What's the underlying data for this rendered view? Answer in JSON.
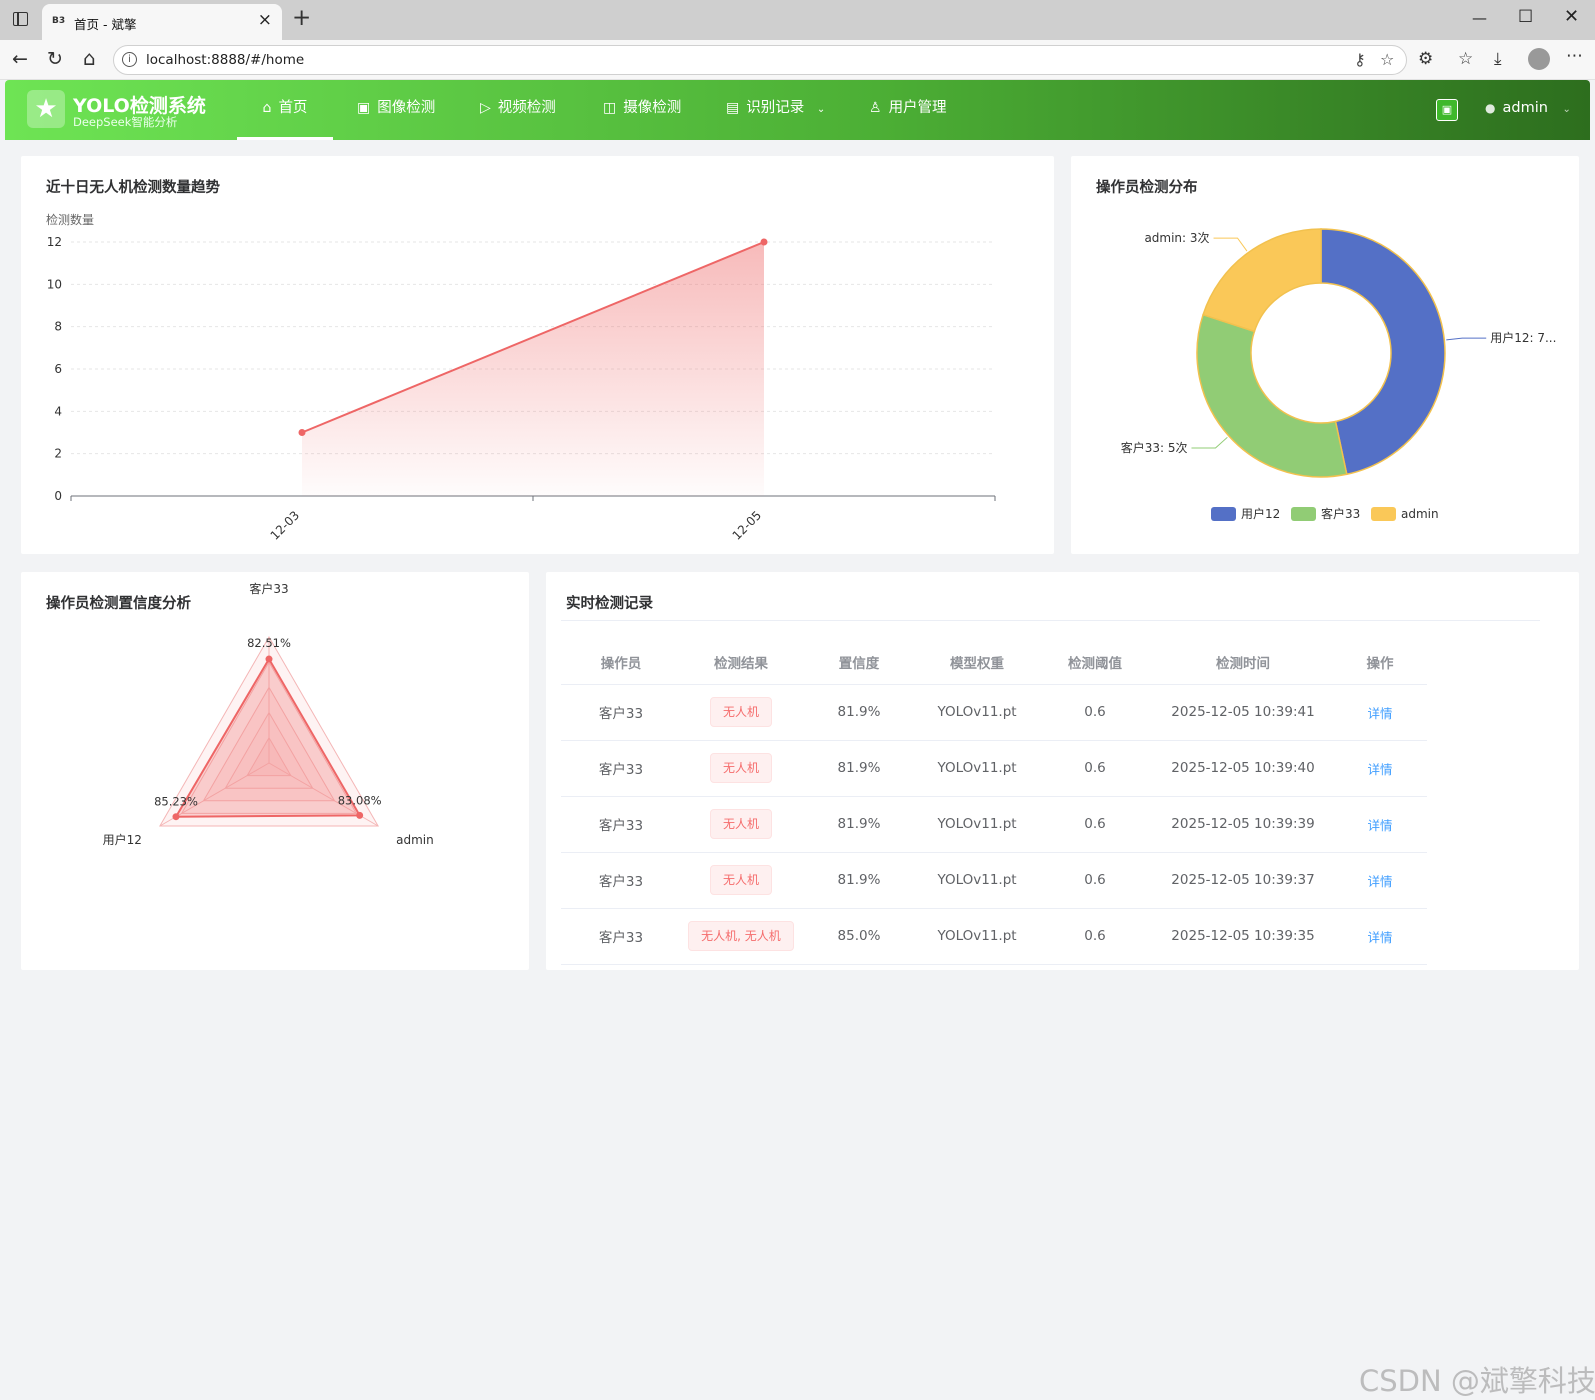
{
  "browser": {
    "tab_favicon": "B3",
    "tab_title": "首页 - 斌擎",
    "url": "localhost:8888/#/home"
  },
  "header": {
    "logo_title": "YOLO检测系统",
    "logo_subtitle": "DeepSeek智能分析",
    "nav": [
      {
        "label": "首页",
        "icon": "home-icon"
      },
      {
        "label": "图像检测",
        "icon": "image-icon"
      },
      {
        "label": "视频检测",
        "icon": "play-icon"
      },
      {
        "label": "摄像检测",
        "icon": "camera-icon"
      },
      {
        "label": "识别记录",
        "icon": "document-icon"
      },
      {
        "label": "用户管理",
        "icon": "user-icon"
      }
    ],
    "active_nav": "首页",
    "user_name": "admin"
  },
  "trend_card": {
    "title": "近十日无人机检测数量趋势"
  },
  "distribution_card": {
    "title": "操作员检测分布"
  },
  "radar_card": {
    "title": "操作员检测置信度分析"
  },
  "records_card": {
    "title": "实时检测记录",
    "columns": [
      "操作员",
      "检测结果",
      "置信度",
      "模型权重",
      "检测阈值",
      "检测时间",
      "操作"
    ],
    "rows": [
      {
        "operator": "客户33",
        "result": "无人机",
        "confidence": "81.9%",
        "model": "YOLOv11.pt",
        "threshold": "0.6",
        "time": "2025-12-05 10:39:41",
        "action": "详情"
      },
      {
        "operator": "客户33",
        "result": "无人机",
        "confidence": "81.9%",
        "model": "YOLOv11.pt",
        "threshold": "0.6",
        "time": "2025-12-05 10:39:40",
        "action": "详情"
      },
      {
        "operator": "客户33",
        "result": "无人机",
        "confidence": "81.9%",
        "model": "YOLOv11.pt",
        "threshold": "0.6",
        "time": "2025-12-05 10:39:39",
        "action": "详情"
      },
      {
        "operator": "客户33",
        "result": "无人机",
        "confidence": "81.9%",
        "model": "YOLOv11.pt",
        "threshold": "0.6",
        "time": "2025-12-05 10:39:37",
        "action": "详情"
      },
      {
        "operator": "客户33",
        "result": "无人机, 无人机",
        "confidence": "85.0%",
        "model": "YOLOv11.pt",
        "threshold": "0.6",
        "time": "2025-12-05 10:39:35",
        "action": "详情"
      }
    ]
  },
  "chart_data": [
    {
      "type": "area",
      "categories": [
        "12-03",
        "12-05"
      ],
      "values": [
        3,
        12
      ],
      "ylabel": "检测数量",
      "ylim": [
        0,
        12
      ],
      "yticks": [
        "0",
        "2",
        "4",
        "6",
        "8",
        "10",
        "12"
      ],
      "color": "#ee6666",
      "grid": true
    },
    {
      "type": "pie",
      "donut": true,
      "labels": [
        "用户12",
        "客户33",
        "admin"
      ],
      "values": [
        7,
        5,
        3
      ],
      "slice_labels": [
        "用户12: 7...",
        "客户33: 5次",
        "admin: 3次"
      ],
      "colors": [
        "#5470c6",
        "#91cc75",
        "#fac858"
      ],
      "legend": "bottom"
    },
    {
      "type": "radar",
      "indicators": [
        "客户33",
        "admin",
        "用户12"
      ],
      "values": [
        82.51,
        83.08,
        85.23
      ],
      "value_labels": [
        "82.51%",
        "83.08%",
        "85.23%"
      ],
      "max": 100,
      "color": "#ee6666"
    }
  ],
  "watermark": "CSDN @斌擎科技"
}
